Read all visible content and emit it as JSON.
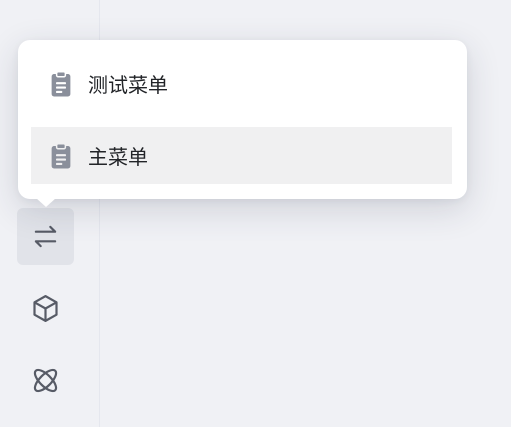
{
  "sidebar": {
    "items": [
      {
        "icon": "arrows-right-left-icon",
        "active": true
      },
      {
        "icon": "cube-icon",
        "active": false
      },
      {
        "icon": "atom-icon",
        "active": false
      }
    ]
  },
  "popup_menu": {
    "items": [
      {
        "label": "测试菜单",
        "icon": "clipboard-list-icon",
        "hovered": false
      },
      {
        "label": "主菜单",
        "icon": "clipboard-list-icon",
        "hovered": true
      }
    ]
  },
  "colors": {
    "background": "#f0f1f5",
    "popup_background": "#ffffff",
    "hover_row": "#f0f0f1",
    "active_sidebar_button": "#e1e3e9",
    "icon_gray": "#575b66",
    "clipboard_icon": "#8a8f9b",
    "text": "#222428"
  }
}
